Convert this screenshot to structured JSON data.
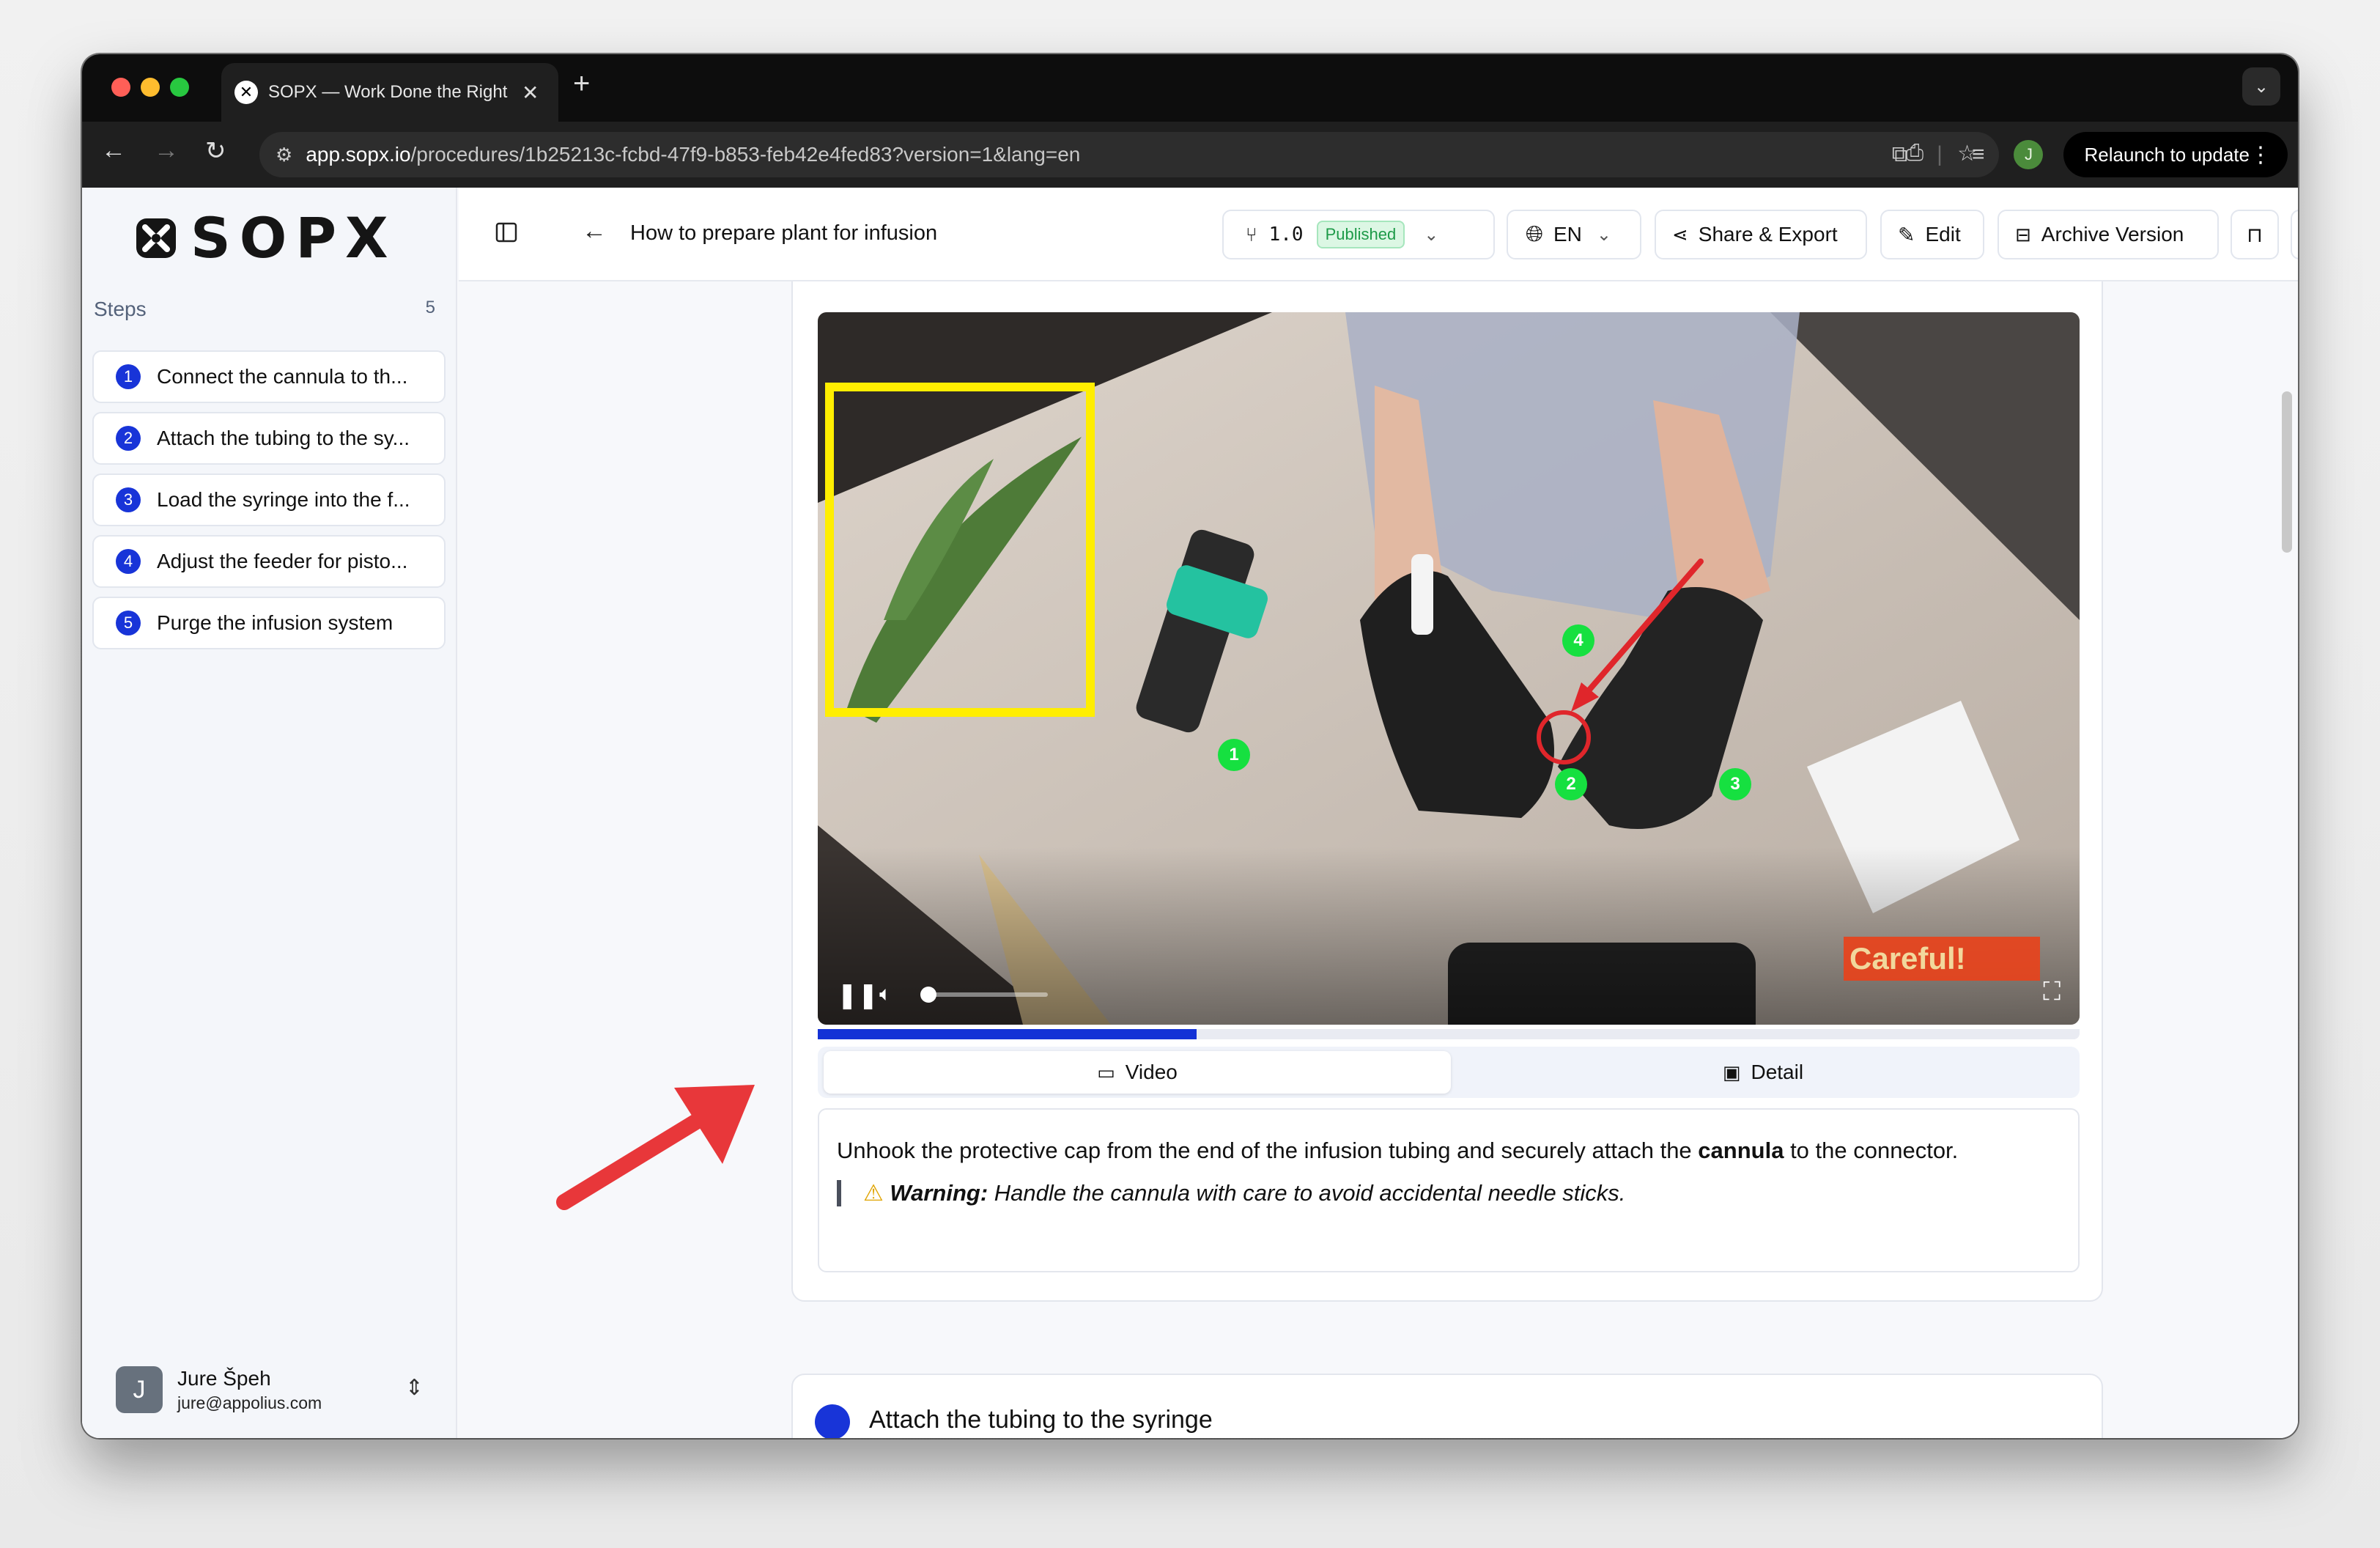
{
  "browser": {
    "tab_title": "SOPX — Work Done the Right",
    "url_host": "app.sopx.io",
    "url_path": "/procedures/1b25213c-fcbd-47f9-b853-feb42e4fed83?version=1&lang=en",
    "relaunch_label": "Relaunch to update",
    "profile_initial": "J"
  },
  "brand": {
    "logo_text": "SOPX"
  },
  "sidebar": {
    "steps_label": "Steps",
    "steps_count": "5",
    "items": [
      {
        "num": "1",
        "label": "Connect the cannula to th..."
      },
      {
        "num": "2",
        "label": "Attach the tubing to the sy..."
      },
      {
        "num": "3",
        "label": "Load the syringe into the f..."
      },
      {
        "num": "4",
        "label": "Adjust the feeder for pisto..."
      },
      {
        "num": "5",
        "label": "Purge the infusion system"
      }
    ],
    "user": {
      "initial": "J",
      "name": "Jure Špeh",
      "email": "jure@appolius.com"
    }
  },
  "header": {
    "title": "How to prepare plant for infusion",
    "version": "1.0",
    "status": "Published",
    "language": "EN",
    "share_label": "Share & Export",
    "edit_label": "Edit",
    "archive_label": "Archive Version"
  },
  "step_card": {
    "video": {
      "overlay_text": "Careful!",
      "markers": [
        "1",
        "2",
        "3",
        "4"
      ],
      "progress": 0.3
    },
    "tabs": {
      "video": "Video",
      "detail": "Detail"
    },
    "description_before": "Unhook the protective cap from the end of the infusion tubing and securely attach the ",
    "description_bold": "cannula",
    "description_after": " to the connector.",
    "warning_label": "Warning:",
    "warning_text": " Handle the cannula with care to avoid accidental needle sticks."
  },
  "next_card": {
    "title": "Attach the tubing to the syringe"
  },
  "colors": {
    "accent": "#1834d8",
    "published": "#1d9a48",
    "annotation": "#e8373a"
  }
}
